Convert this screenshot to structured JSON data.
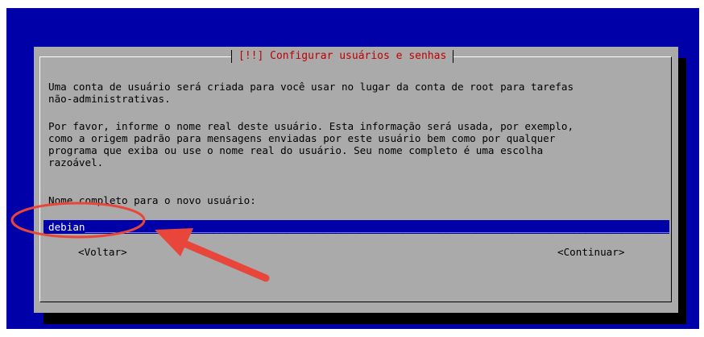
{
  "dialog": {
    "title": "[!!] Configurar usuários e senhas",
    "paragraph1": "Uma conta de usuário será criada para você usar no lugar da conta de root para tarefas\nnão-administrativas.",
    "paragraph2": "Por favor, informe o nome real deste usuário. Esta informação será usada, por exemplo,\ncomo a origem padrão para mensagens enviadas por este usuário bem como por qualquer\nprograma que exiba ou use o nome real do usuário. Seu nome completo é uma escolha\nrazoável.",
    "prompt": "Nome completo para o novo usuário:",
    "input_value": "debian",
    "back_label": "<Voltar>",
    "continue_label": "<Continuar>"
  },
  "colors": {
    "screen_background": "#0000a8",
    "dialog_background": "#aaaaaa",
    "title_text": "#c00000",
    "input_background": "#0000a8",
    "annotation": "#e8463b"
  },
  "annotation": {
    "shapes": [
      "ellipse-highlight",
      "arrow"
    ],
    "target": "input-field"
  }
}
